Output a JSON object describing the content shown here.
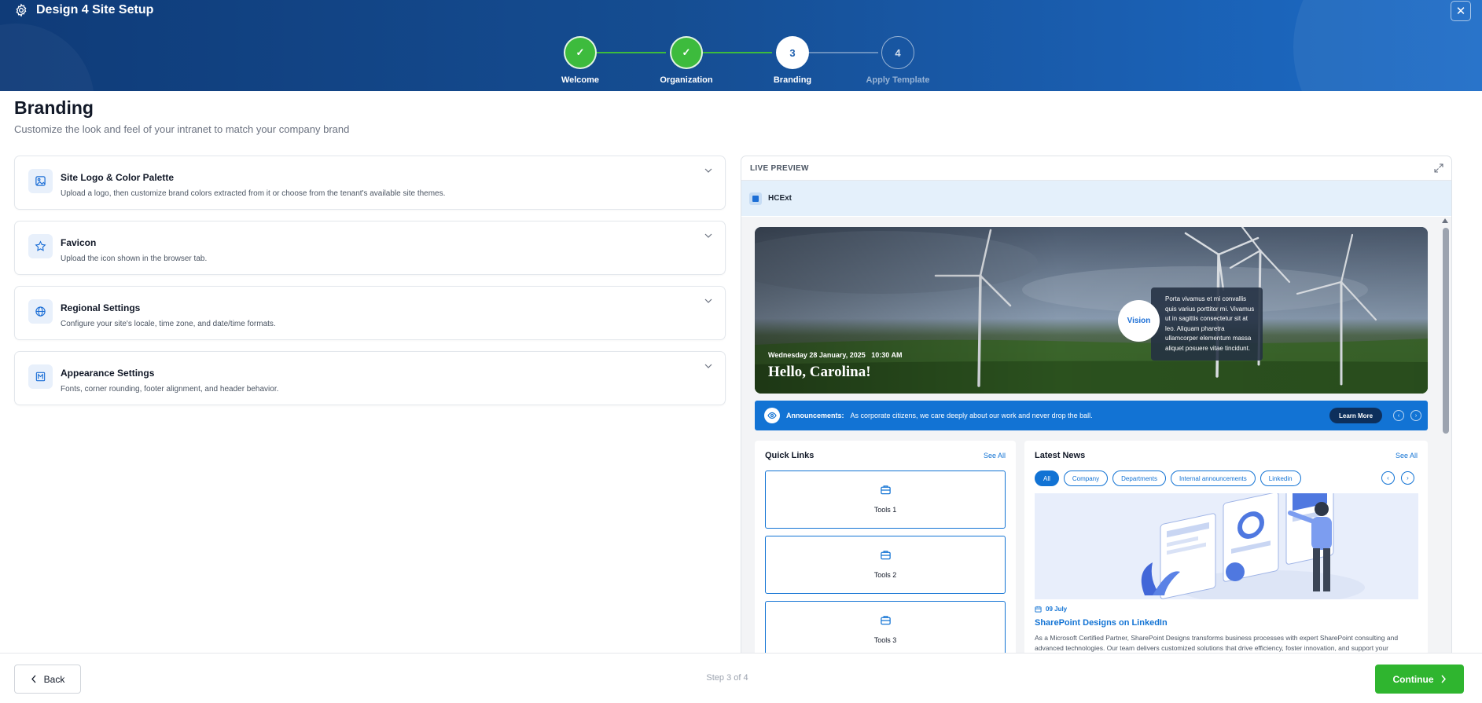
{
  "header": {
    "app_title": "Design 4 Site Setup",
    "close_glyph": "✕",
    "steps": [
      {
        "label": "Welcome",
        "mark": "✓",
        "state": "done"
      },
      {
        "label": "Organization",
        "mark": "✓",
        "state": "done"
      },
      {
        "label": "Branding",
        "mark": "3",
        "state": "active"
      },
      {
        "label": "Apply Template",
        "mark": "4",
        "state": "todo"
      }
    ]
  },
  "page": {
    "title": "Branding",
    "subtitle": "Customize the look and feel of your intranet to match your company brand"
  },
  "sections": [
    {
      "title": "Site Logo & Color Palette",
      "desc": "Upload a logo, then customize brand colors extracted from it or choose from the tenant's available site themes.",
      "icon": "image-icon"
    },
    {
      "title": "Favicon",
      "desc": "Upload the icon shown in the browser tab.",
      "icon": "star-icon"
    },
    {
      "title": "Regional Settings",
      "desc": "Configure your site's locale, time zone, and date/time formats.",
      "icon": "globe-icon"
    },
    {
      "title": "Appearance Settings",
      "desc": "Fonts, corner rounding, footer alignment, and header behavior.",
      "icon": "palette-icon"
    }
  ],
  "preview": {
    "label": "LIVE PREVIEW",
    "site_name": "HCExt",
    "hero": {
      "date": "Wednesday 28 January, 2025",
      "time": "10:30 AM",
      "greeting": "Hello, Carolina!",
      "vision_label": "Vision",
      "vision_text": "Porta vivamus et mi convallis quis varius porttitor mi. Vivamus ut in sagittis consectetur sit at leo. Aliquam pharetra ullamcorper elementum massa aliquet posuere vitae tincidunt."
    },
    "announcement": {
      "label": "Announcements:",
      "text": "As corporate citizens, we care deeply about our work and never drop the ball.",
      "button": "Learn More",
      "prev": "‹",
      "next": "›"
    },
    "quick_links": {
      "title": "Quick Links",
      "see_all": "See All",
      "items": [
        "Tools 1",
        "Tools 2",
        "Tools 3"
      ]
    },
    "news": {
      "title": "Latest News",
      "see_all": "See All",
      "filters": [
        "All",
        "Company",
        "Departments",
        "Internal announcements",
        "Linkedin"
      ],
      "prev": "‹",
      "next": "›",
      "date": "09 July",
      "headline": "SharePoint Designs on LinkedIn",
      "body": "As a Microsoft Certified Partner, SharePoint Designs transforms business processes with expert SharePoint consulting and advanced technologies. Our team delivers customized solutions that drive efficiency, foster innovation, and support your"
    }
  },
  "footer": {
    "back": "Back",
    "step_count": "Step 3 of 4",
    "continue": "Continue"
  },
  "colors": {
    "header_start": "#0f3b78",
    "header_end": "#1c6cc7",
    "success": "#3dbb3d",
    "accent": "#1273d4",
    "continue": "#2fb52f"
  }
}
